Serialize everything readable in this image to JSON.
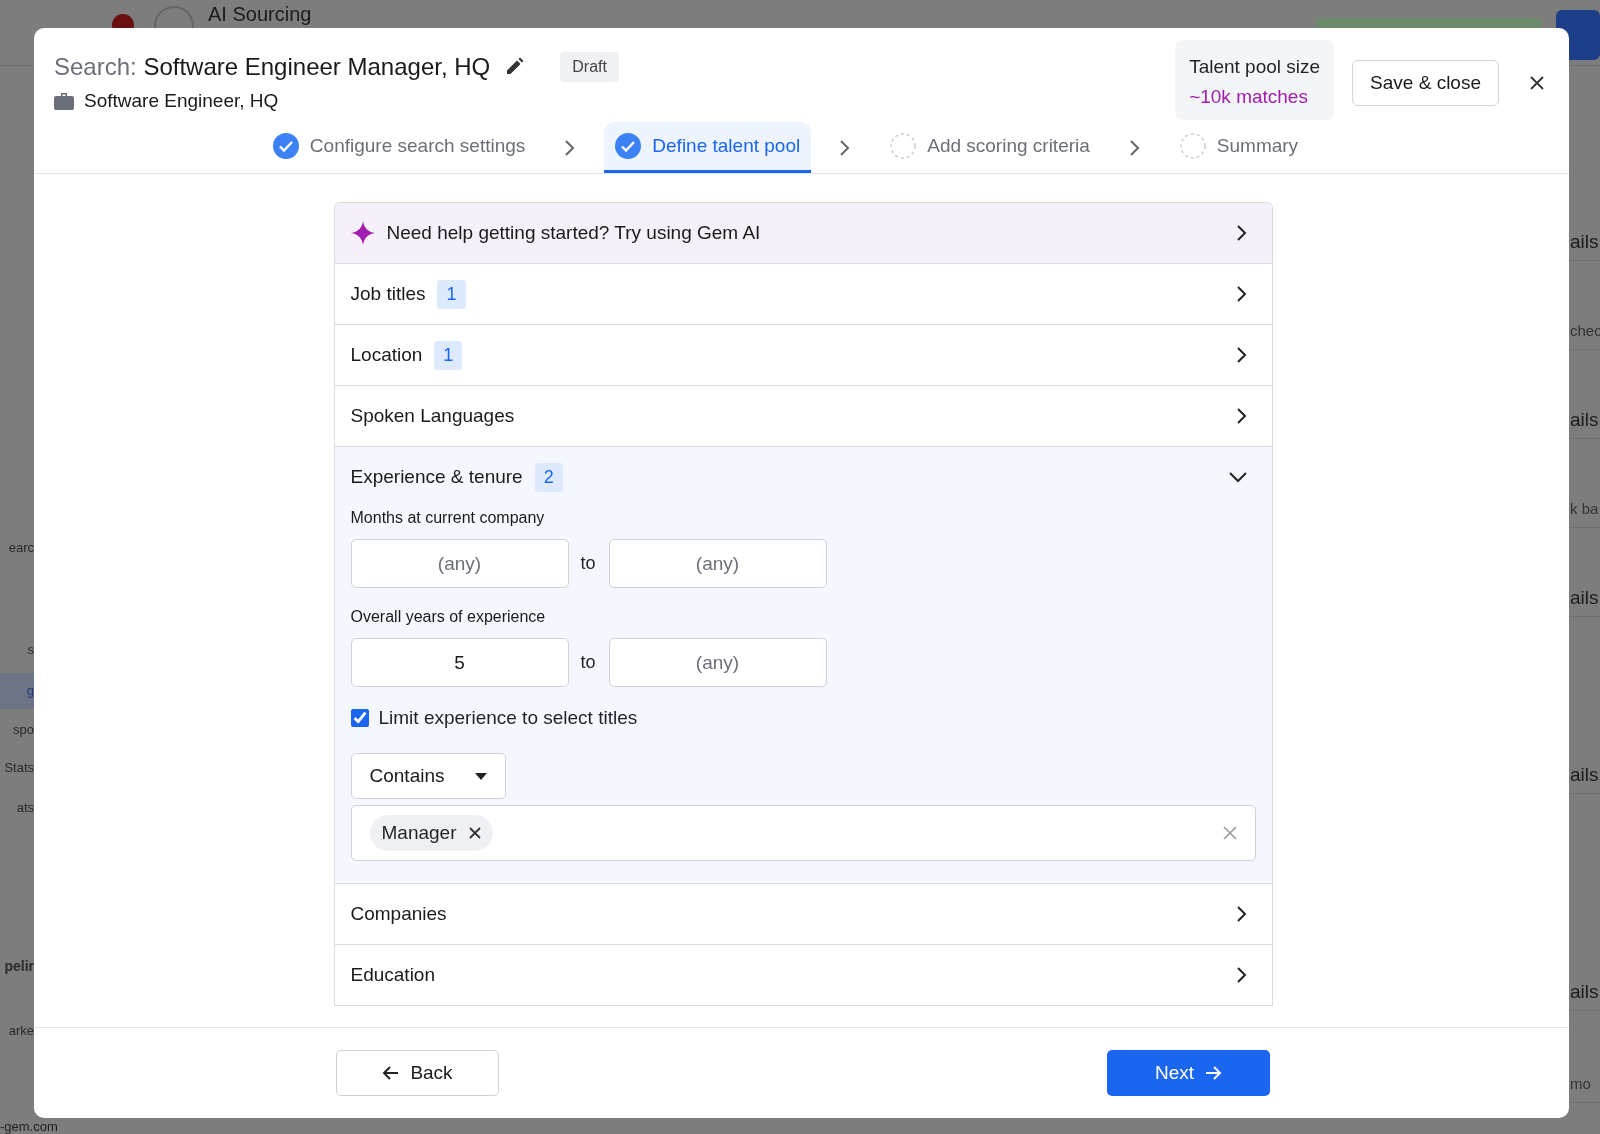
{
  "background": {
    "app_title": "AI Sourcing",
    "left_fragments": [
      {
        "text": "earc",
        "kind": "item",
        "selected": false
      },
      {
        "text": "s",
        "kind": "item",
        "selected": false
      },
      {
        "text": "g",
        "kind": "item",
        "selected": true
      },
      {
        "text": "spo",
        "kind": "item",
        "selected": false
      },
      {
        "text": "Stats",
        "kind": "item",
        "selected": false
      },
      {
        "text": "ats",
        "kind": "item",
        "selected": false
      },
      {
        "text": "pelir",
        "kind": "heading",
        "selected": false
      },
      {
        "text": "arke",
        "kind": "item",
        "selected": false
      }
    ],
    "right_fragments": [
      {
        "text": "ails",
        "kind": "heading"
      },
      {
        "text": "chec",
        "kind": "note"
      },
      {
        "text": "ails",
        "kind": "heading"
      },
      {
        "text": "k ba",
        "kind": "note"
      },
      {
        "text": "ails",
        "kind": "heading"
      },
      {
        "text": "ails",
        "kind": "heading"
      },
      {
        "text": "ails",
        "kind": "heading"
      },
      {
        "text": "mo",
        "kind": "note"
      }
    ],
    "footer_fragment": "-gem.com"
  },
  "modal": {
    "title_prefix": "Search:",
    "title": "Software Engineer Manager, HQ",
    "status_badge": "Draft",
    "subtitle": "Software Engineer, HQ",
    "talent_pool": {
      "label": "Talent pool size",
      "value": "~10k matches"
    },
    "save_button": "Save & close",
    "steps": [
      {
        "label": "Configure search settings",
        "done": true,
        "selected": false
      },
      {
        "label": "Define talent pool",
        "done": true,
        "selected": true
      },
      {
        "label": "Add scoring criteria",
        "done": false,
        "selected": false
      },
      {
        "label": "Summary",
        "done": false,
        "selected": false
      }
    ],
    "sections": [
      {
        "kind": "ai",
        "label": "Need help getting started? Try using Gem AI",
        "expanded": false
      },
      {
        "kind": "filter",
        "label": "Job titles",
        "count": "1",
        "expanded": false
      },
      {
        "kind": "filter",
        "label": "Location",
        "count": "1",
        "expanded": false
      },
      {
        "kind": "filter",
        "label": "Spoken Languages",
        "expanded": false
      },
      {
        "kind": "filter",
        "label": "Experience & tenure",
        "count": "2",
        "expanded": true,
        "ranges": [
          {
            "label": "Months at current company",
            "from": {
              "placeholder": "(any)"
            },
            "joiner": "to",
            "to": {
              "placeholder": "(any)"
            }
          },
          {
            "label": "Overall years of experience",
            "from": {
              "value": "5"
            },
            "joiner": "to",
            "to": {
              "placeholder": "(any)"
            }
          }
        ],
        "limit_checkbox": {
          "label": "Limit experience to select titles",
          "checked": true
        },
        "match_dropdown": "Contains",
        "title_tags": [
          "Manager"
        ]
      },
      {
        "kind": "filter",
        "label": "Companies",
        "expanded": false
      },
      {
        "kind": "filter",
        "label": "Education",
        "expanded": false
      }
    ],
    "back_button": "Back",
    "next_button": "Next"
  }
}
